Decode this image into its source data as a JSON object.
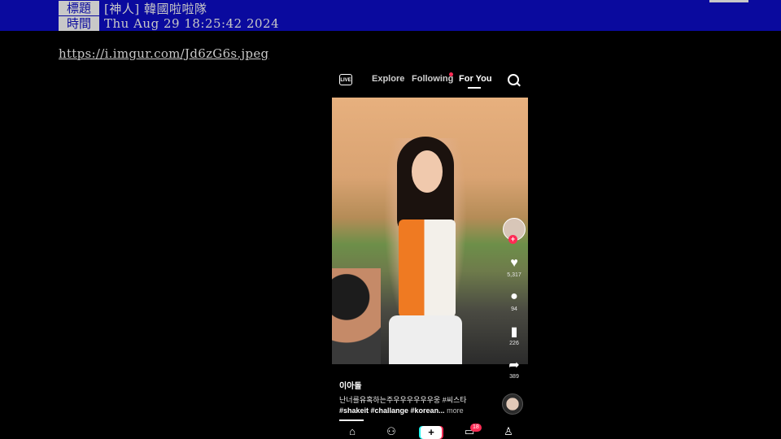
{
  "header": {
    "title_label": "標題",
    "title_value": "[神人] 韓國啦啦隊",
    "time_label": "時間",
    "time_value": "Thu Aug 29 18:25:42 2024"
  },
  "link": {
    "url": "https://i.imgur.com/Jd6zG6s.jpeg"
  },
  "phone": {
    "topnav": {
      "live_label": "LIVE",
      "tabs": [
        {
          "label": "Explore"
        },
        {
          "label": "Following"
        },
        {
          "label": "For You"
        }
      ],
      "active_tab": "For You"
    },
    "rail": {
      "likes": "5,317",
      "comments": "94",
      "saves": "226",
      "shares": "389"
    },
    "post": {
      "username": "이아돌",
      "caption": "난너를유혹하는주우우우우우우웅 #씨스타",
      "hashtags": "#shakeit #challange #korean...",
      "more": "more"
    },
    "bottomnav": {
      "inbox_badge": "18"
    },
    "colors": {
      "accent": "#fe2c55",
      "cyan": "#25f4ee"
    }
  }
}
